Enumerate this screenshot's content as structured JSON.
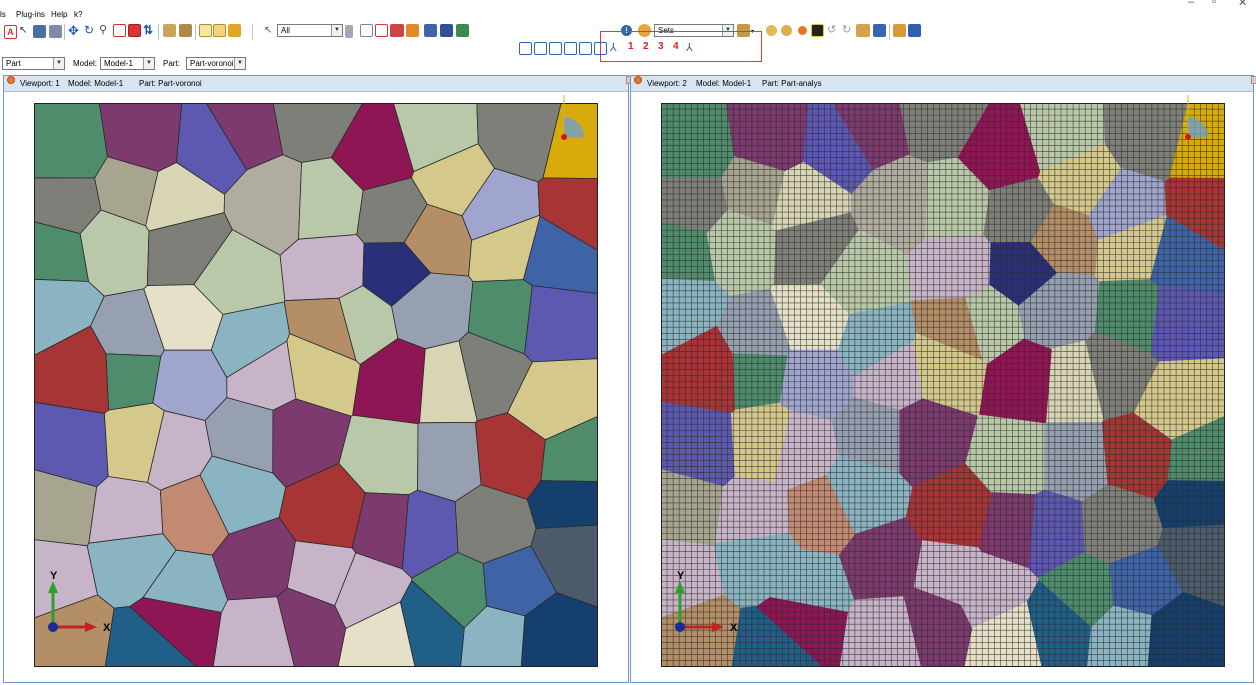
{
  "menu": {
    "items": [
      "ls",
      "Plug-ins",
      "Help",
      "k?"
    ]
  },
  "toolbar": {
    "selection_filter": "All",
    "sets_combo": "Sets",
    "view_numbers": [
      "1",
      "2",
      "3",
      "4"
    ]
  },
  "context": {
    "module_value": "Part",
    "model_label": "Model:",
    "model_value": "Model-1",
    "part_label": "Part:",
    "part_value": "Part-voronoi"
  },
  "viewports": [
    {
      "name": "Viewport: 1",
      "model": "Model: Model-1",
      "part": "Part: Part-voronoi"
    },
    {
      "name": "Viewport: 2",
      "model": "Model: Model-1",
      "part": "Part: Part-analys"
    }
  ],
  "triad": {
    "x": "X",
    "y": "Y"
  },
  "colors": {
    "mesh_line": "#2b2b2b",
    "triad_x": "#c0251f",
    "triad_y": "#2aa12a",
    "triad_origin": "#1a2a9a",
    "highlight": "#e03a3a"
  }
}
